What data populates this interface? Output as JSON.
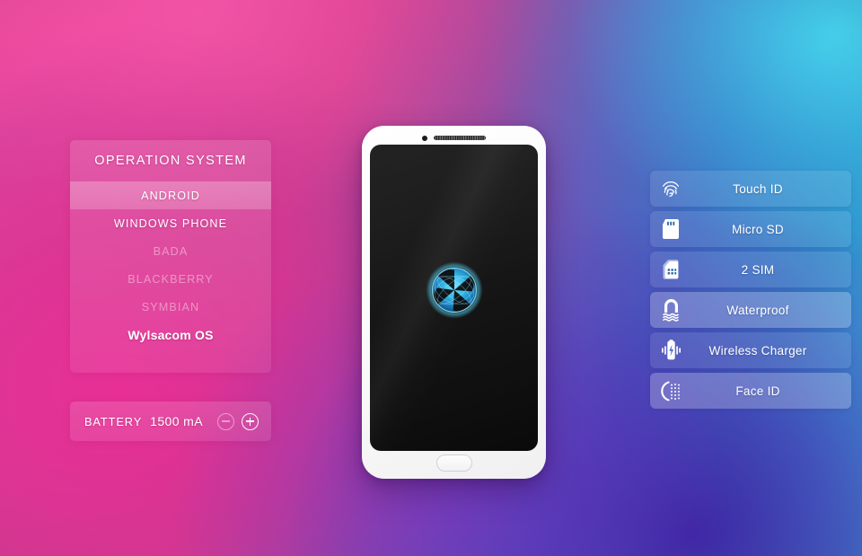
{
  "background": {
    "pink": "#ef4a9e",
    "cyan": "#35c3e4",
    "indigo": "#3f1ea0",
    "purple": "#7c38c4"
  },
  "os_panel": {
    "title": "OPERATION SYSTEM",
    "items": [
      {
        "label": "ANDROID",
        "state": "selected"
      },
      {
        "label": "WINDOWS PHONE",
        "state": "normal"
      },
      {
        "label": "BADA",
        "state": "dim"
      },
      {
        "label": "BLACKBERRY",
        "state": "dim"
      },
      {
        "label": "SYMBIAN",
        "state": "dim"
      },
      {
        "label": "Wylsacom OS",
        "state": "brand"
      }
    ]
  },
  "battery": {
    "label": "BATTERY",
    "value": "1500 mA",
    "decrease_label": "−",
    "increase_label": "+",
    "decrease_icon": "minus-circle-icon",
    "increase_icon": "plus-circle-icon"
  },
  "phone": {
    "camera_icon": "front-camera-icon",
    "speaker_icon": "earpiece-speaker-icon",
    "home_button_icon": "home-button-icon",
    "logo_icon": "wylsacom-logo-icon",
    "screen_color": "#111111",
    "body_color": "#ffffff"
  },
  "features": [
    {
      "label": "Touch ID",
      "icon": "fingerprint-icon",
      "state": "normal"
    },
    {
      "label": "Micro SD",
      "icon": "sd-card-icon",
      "state": "normal"
    },
    {
      "label": "2 SIM",
      "icon": "sim-card-icon",
      "state": "normal"
    },
    {
      "label": "Waterproof",
      "icon": "waterproof-icon",
      "state": "highlight"
    },
    {
      "label": "Wireless Charger",
      "icon": "wireless-charging-icon",
      "state": "normal"
    },
    {
      "label": "Face ID",
      "icon": "face-id-icon",
      "state": "highlight"
    }
  ]
}
